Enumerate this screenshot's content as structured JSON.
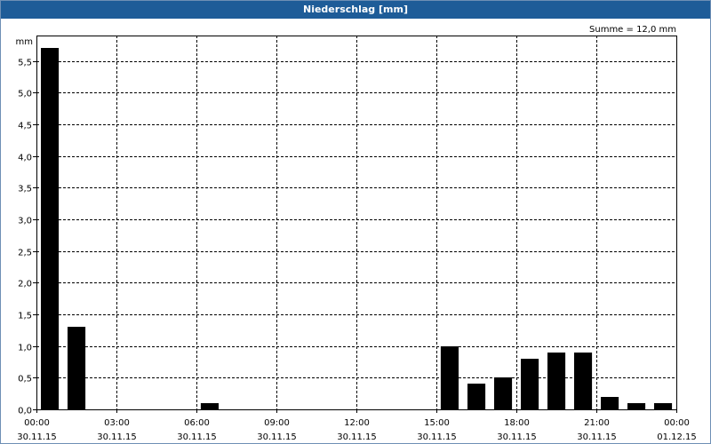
{
  "window": {
    "title": "Niederschlag [mm]"
  },
  "summary": "Summe = 12,0 mm",
  "colors": {
    "titlebar": "#1e5c98",
    "bars": "#000000",
    "grid": "#000000"
  },
  "chart_data": {
    "type": "bar",
    "title": "Niederschlag [mm]",
    "ylabel": "mm",
    "ylim": [
      0,
      5.9
    ],
    "grid": true,
    "yticks": [
      "0,0",
      "0,5",
      "1,0",
      "1,5",
      "2,0",
      "2,5",
      "3,0",
      "3,5",
      "4,0",
      "4,5",
      "5,0",
      "5,5"
    ],
    "ytick_values": [
      0,
      0.5,
      1,
      1.5,
      2,
      2.5,
      3,
      3.5,
      4,
      4.5,
      5,
      5.5
    ],
    "xticks": [
      {
        "time": "00:00",
        "date": "30.11.15"
      },
      {
        "time": "03:00",
        "date": "30.11.15"
      },
      {
        "time": "06:00",
        "date": "30.11.15"
      },
      {
        "time": "09:00",
        "date": "30.11.15"
      },
      {
        "time": "12:00",
        "date": "30.11.15"
      },
      {
        "time": "15:00",
        "date": "30.11.15"
      },
      {
        "time": "18:00",
        "date": "30.11.15"
      },
      {
        "time": "21:00",
        "date": "30.11.15"
      },
      {
        "time": "00:00",
        "date": "01.12.15"
      }
    ],
    "categories": [
      "00:00",
      "01:00",
      "02:00",
      "03:00",
      "04:00",
      "05:00",
      "06:00",
      "07:00",
      "08:00",
      "09:00",
      "10:00",
      "11:00",
      "12:00",
      "13:00",
      "14:00",
      "15:00",
      "16:00",
      "17:00",
      "18:00",
      "19:00",
      "20:00",
      "21:00",
      "22:00",
      "23:00"
    ],
    "values": [
      5.7,
      1.3,
      0,
      0,
      0,
      0,
      0.1,
      0,
      0,
      0,
      0,
      0,
      0,
      0,
      0,
      1.0,
      0.4,
      0.5,
      0.8,
      0.9,
      0.9,
      0.2,
      0.1,
      0.1
    ]
  }
}
